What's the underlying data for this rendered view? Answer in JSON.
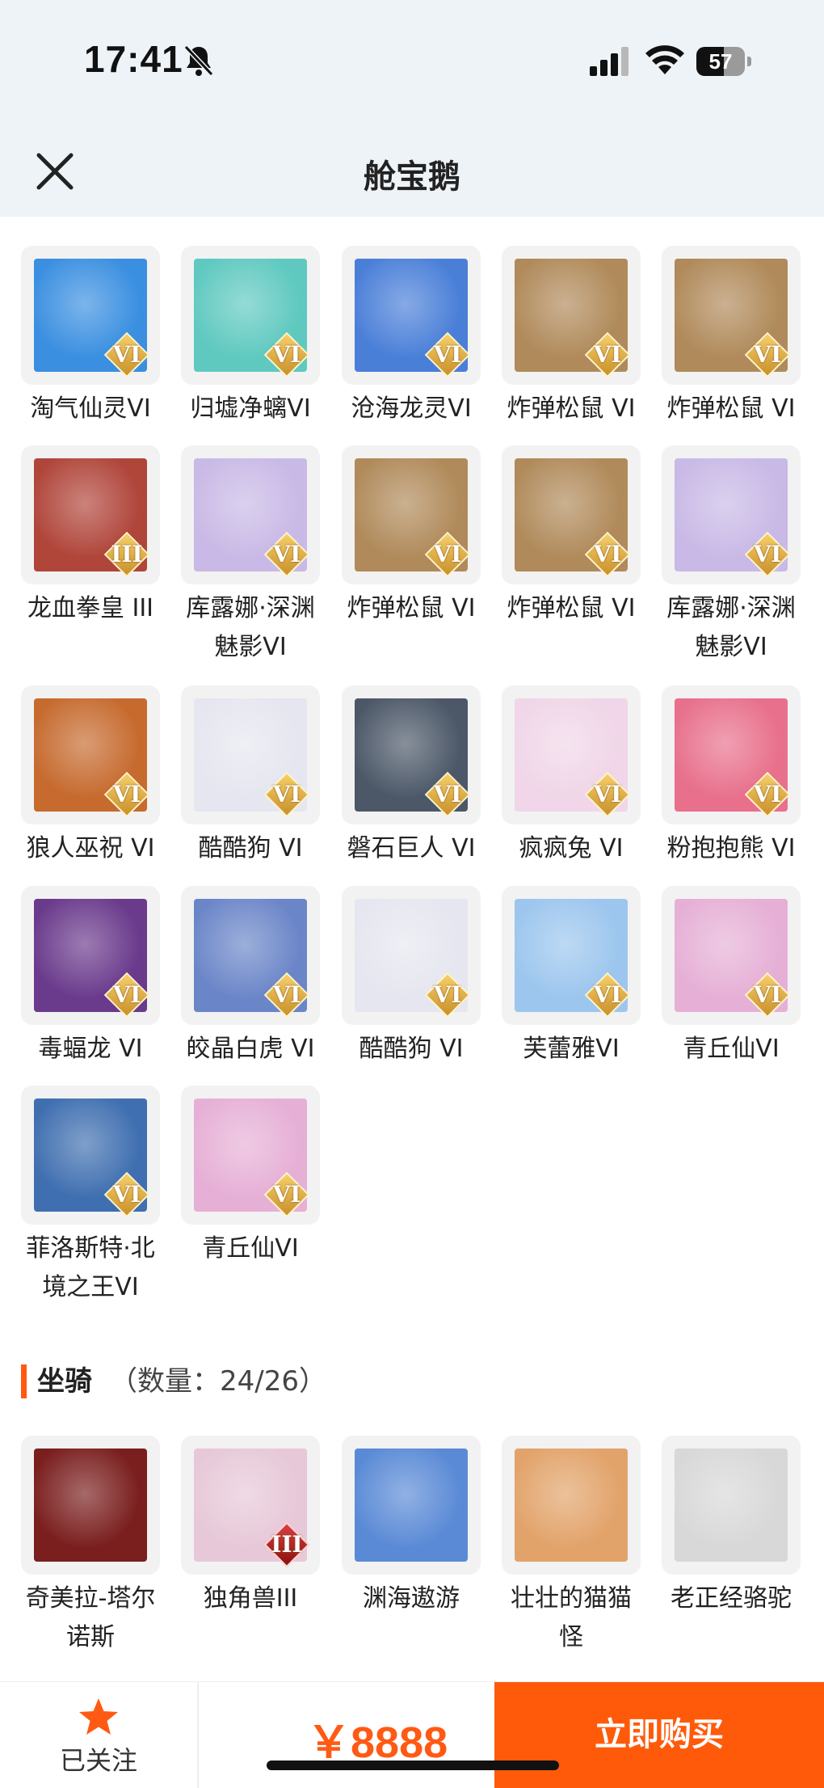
{
  "status": {
    "time": "17:41",
    "battery": "57",
    "battery_level": 0.57
  },
  "nav": {
    "title": "舱宝鹅",
    "close_icon": "close-icon"
  },
  "pets": [
    {
      "name": "淘气仙灵VI",
      "rank": "VI",
      "color": "#3a8fe0"
    },
    {
      "name": "归墟净螭VI",
      "rank": "VI",
      "color": "#5fc9c0"
    },
    {
      "name": "沧海龙灵VI",
      "rank": "VI",
      "color": "#4a7fd8"
    },
    {
      "name": "炸弹松鼠 VI",
      "rank": "VI",
      "color": "#b08a5a"
    },
    {
      "name": "炸弹松鼠 VI",
      "rank": "VI",
      "color": "#b08a5a"
    },
    {
      "name": "龙血拳皇 III",
      "rank": "III",
      "color": "#b0453a"
    },
    {
      "name": "库露娜·深渊魅影VI",
      "rank": "VI",
      "color": "#c9b9e6"
    },
    {
      "name": "炸弹松鼠 VI",
      "rank": "VI",
      "color": "#b08a5a"
    },
    {
      "name": "炸弹松鼠 VI",
      "rank": "VI",
      "color": "#b08a5a"
    },
    {
      "name": "库露娜·深渊魅影VI",
      "rank": "VI",
      "color": "#c9b9e6"
    },
    {
      "name": "狼人巫祝 VI",
      "rank": "VI",
      "color": "#c66a2e"
    },
    {
      "name": "酷酷狗 VI",
      "rank": "VI",
      "color": "#e6e6f0"
    },
    {
      "name": "磐石巨人 VI",
      "rank": "VI",
      "color": "#4c5868"
    },
    {
      "name": "疯疯兔 VI",
      "rank": "VI",
      "color": "#f0d6e8"
    },
    {
      "name": "粉抱抱熊 VI",
      "rank": "VI",
      "color": "#e8708c"
    },
    {
      "name": "毒蝠龙 VI",
      "rank": "VI",
      "color": "#6a3a8c"
    },
    {
      "name": "皎晶白虎 VI",
      "rank": "VI",
      "color": "#6b86c8"
    },
    {
      "name": "酷酷狗 VI",
      "rank": "VI",
      "color": "#e6e6f0"
    },
    {
      "name": "芙蕾雅VI",
      "rank": "VI",
      "color": "#9cc6ee"
    },
    {
      "name": "青丘仙VI",
      "rank": "VI",
      "color": "#e6b0d6"
    },
    {
      "name": "菲洛斯特·北境之王VI",
      "rank": "VI",
      "color": "#3f6fb0"
    },
    {
      "name": "青丘仙VI",
      "rank": "VI",
      "color": "#e6b0d6"
    }
  ],
  "mounts_section": {
    "title": "坐骑",
    "count": "（数量：24/26）"
  },
  "mounts": [
    {
      "name": "奇美拉-塔尔诺斯",
      "rank": "",
      "color": "#7a1e1e"
    },
    {
      "name": "独角兽III",
      "rank": "III",
      "color": "#e7c8d8"
    },
    {
      "name": "渊海遨游",
      "rank": "",
      "color": "#5a8ad6"
    },
    {
      "name": "壮壮的猫猫怪",
      "rank": "",
      "color": "#e2a36a"
    },
    {
      "name": "老正经骆驼",
      "rank": "",
      "color": "#d8d8d8"
    }
  ],
  "bottom": {
    "follow_label": "已关注",
    "follow_icon": "star-icon",
    "price": "￥8888",
    "buy_label": "立即购买"
  },
  "colors": {
    "accent": "#ff5a14",
    "buy_button": "#ff5a0a",
    "header_bg": "#eef3f7"
  }
}
